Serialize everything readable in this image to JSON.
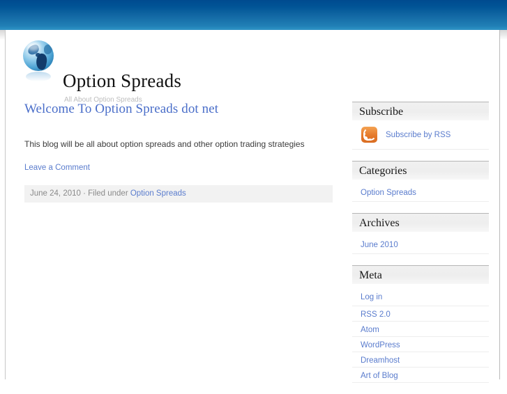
{
  "site": {
    "title": "Option Spreads",
    "description": "All About Option Spreads",
    "logo_icon": "globe-icon"
  },
  "post": {
    "title": "Welcome To Option Spreads dot net",
    "body": "This blog will be all about option spreads and other option trading strategies",
    "comment_link": "Leave a Comment",
    "meta_date": "June 24, 2010",
    "meta_separator": " · Filed under ",
    "meta_category": "Option Spreads"
  },
  "sidebar": {
    "subscribe": {
      "title": "Subscribe",
      "icon": "rss-icon",
      "link_label": "Subscribe by RSS"
    },
    "categories": {
      "title": "Categories",
      "items": [
        {
          "label": "Option Spreads"
        }
      ]
    },
    "archives": {
      "title": "Archives",
      "items": [
        {
          "label": "June 2010"
        }
      ]
    },
    "meta": {
      "title": "Meta",
      "items": [
        {
          "label": "Log in"
        },
        {
          "label": "RSS 2.0"
        },
        {
          "label": "Atom"
        },
        {
          "label": "WordPress"
        },
        {
          "label": "Dreamhost"
        },
        {
          "label": "Art of Blog"
        }
      ]
    }
  },
  "colors": {
    "header_gradient_top": "#004a8f",
    "header_gradient_bottom": "#2b8ec2",
    "link": "#5a7ccd",
    "post_title": "#4a6ec9",
    "rss_orange": "#e5792b",
    "meta_bar_bg": "#f2f2f2"
  }
}
